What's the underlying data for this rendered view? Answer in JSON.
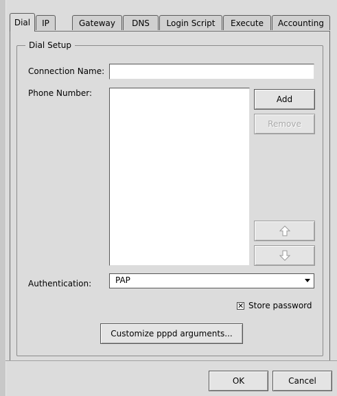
{
  "tabs": [
    {
      "label": "Dial",
      "active": true
    },
    {
      "label": "IP"
    },
    {
      "label": "Gateway"
    },
    {
      "label": "DNS"
    },
    {
      "label": "Login Script"
    },
    {
      "label": "Execute"
    },
    {
      "label": "Accounting"
    }
  ],
  "dial_setup": {
    "group_title": "Dial Setup",
    "connection_name_label": "Connection Name:",
    "connection_name_value": "",
    "phone_number_label": "Phone Number:",
    "phone_numbers": [],
    "add_label": "Add",
    "remove_label": "Remove",
    "move_up_icon": "arrow-up-icon",
    "move_down_icon": "arrow-down-icon",
    "authentication_label": "Authentication:",
    "authentication_value": "PAP",
    "store_password_label": "Store password",
    "store_password_checked": true,
    "customize_label": "Customize pppd arguments..."
  },
  "footer": {
    "ok_label": "OK",
    "cancel_label": "Cancel"
  }
}
